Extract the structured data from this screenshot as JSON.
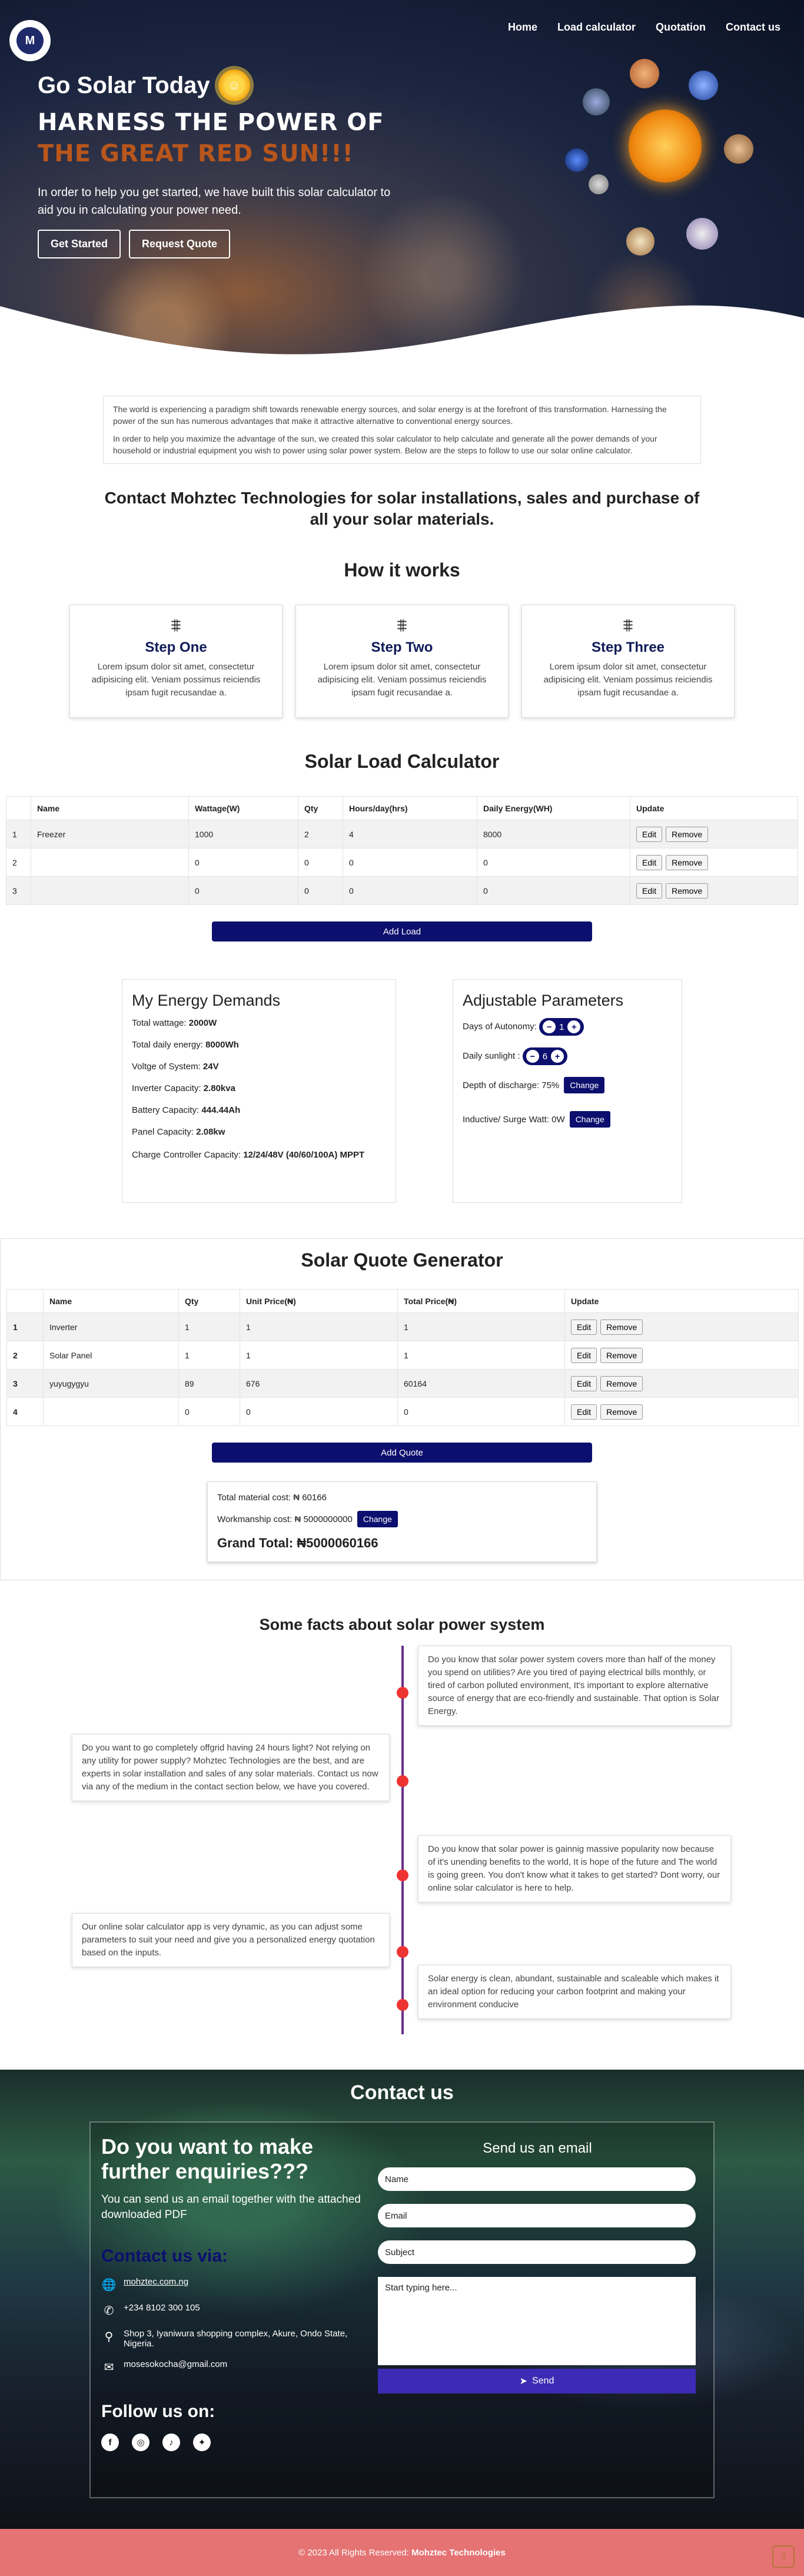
{
  "nav": {
    "logo": "M",
    "items": [
      "Home",
      "Load calculator",
      "Quotation",
      "Contact us"
    ]
  },
  "hero": {
    "title": "Go Solar Today",
    "line1": "HARNESS THE POWER OF",
    "line2": "THE GREAT RED SUN!!!",
    "text": "In order to help you get started, we have built this solar calculator to aid you in calculating your power need.",
    "btn_start": "Get Started",
    "btn_quote": "Request Quote",
    "accent": "#b8561c"
  },
  "intro": {
    "p1": "The world is experiencing a paradigm shift towards renewable energy sources, and solar energy is at the forefront of this transformation. Harnessing the power of the sun has numerous advantages that make it attractive alternative to conventional energy sources.",
    "p2": "In order to help you maximize the advantage of the sun, we created this solar calculator to help calculate and generate all the power demands of your household or industrial equipment you wish to power using solar power system. Below are the steps to follow to use our solar online calculator."
  },
  "contact_heading": "Contact Mohztec Technologies for solar installations, sales and purchase of all your solar materials.",
  "how": {
    "title": "How it works",
    "steps": [
      {
        "title": "Step One",
        "text": "Lorem ipsum dolor sit amet, consectetur adipisicing elit. Veniam possimus reiciendis ipsam fugit recusandae a."
      },
      {
        "title": "Step Two",
        "text": "Lorem ipsum dolor sit amet, consectetur adipisicing elit. Veniam possimus reiciendis ipsam fugit recusandae a."
      },
      {
        "title": "Step Three",
        "text": "Lorem ipsum dolor sit amet, consectetur adipisicing elit. Veniam possimus reiciendis ipsam fugit recusandae a."
      }
    ]
  },
  "calc": {
    "title": "Solar Load Calculator",
    "headers": [
      "",
      "Name",
      "Wattage(W)",
      "Qty",
      "Hours/day(hrs)",
      "Daily Energy(WH)",
      "Update"
    ],
    "rows": [
      [
        "1",
        "Freezer",
        "1000",
        "2",
        "4",
        "8000"
      ],
      [
        "2",
        "",
        "0",
        "0",
        "0",
        "0"
      ],
      [
        "3",
        "",
        "0",
        "0",
        "0",
        "0"
      ]
    ],
    "edit": "Edit",
    "remove": "Remove",
    "add": "Add Load"
  },
  "energy": {
    "title": "My Energy Demands",
    "rows": [
      {
        "label": "Total wattage:",
        "value": "2000W"
      },
      {
        "label": "Total daily energy:",
        "value": "8000Wh"
      },
      {
        "label": "Voltge of System:",
        "value": "24V"
      },
      {
        "label": "Inverter Capacity:",
        "value": "2.80kva"
      },
      {
        "label": "Battery Capacity:",
        "value": "444.44Ah"
      },
      {
        "label": "Panel Capacity:",
        "value": "2.08kw"
      },
      {
        "label": "Charge Controller Capacity:",
        "value": "12/24/48V (40/60/100A) MPPT"
      }
    ]
  },
  "params": {
    "title": "Adjustable Parameters",
    "autonomy_label": "Days of Autonomy:",
    "autonomy": "1",
    "sunlight_label": "Daily sunlight :",
    "sunlight": "6",
    "dod_label": "Depth of discharge: 75%",
    "surge_label": "Inductive/ Surge Watt: 0W",
    "change": "Change"
  },
  "quote": {
    "title": "Solar Quote Generator",
    "headers": [
      "",
      "Name",
      "Qty",
      "Unit Price(₦)",
      "Total Price(₦)",
      "Update"
    ],
    "rows": [
      [
        "1",
        "Inverter",
        "1",
        "1",
        "1"
      ],
      [
        "2",
        "Solar Panel",
        "1",
        "1",
        "1"
      ],
      [
        "3",
        "yuyugygyu",
        "89",
        "676",
        "60164"
      ],
      [
        "4",
        "",
        "0",
        "0",
        "0"
      ]
    ],
    "add": "Add Quote",
    "material_label": "Total material cost:",
    "material": "₦ 60166",
    "workmanship_label": "Workmanship cost:",
    "workmanship": "₦ 5000000000",
    "grand_label": "Grand Total:",
    "grand": "₦5000060166"
  },
  "facts": {
    "title": "Some facts about solar power system",
    "items": [
      "Do you know that solar power system covers more than half of the money you spend on utilities? Are you tired of paying electrical bills monthly, or tired of carbon polluted environment, It's important to explore alternative source of energy that are eco-friendly and sustainable. That option is Solar Energy.",
      "Do you want to go completely offgrid having 24 hours light? Not relying on any utility for power supply? Mohztec Technologies are the best, and are experts in solar installation and sales of any solar materials. Contact us now via any of the medium in the contact section below, we have you covered.",
      "Do you know that solar power is gainnig massive popularity now because of it's unending benefits to the world, It is hope of the future and The world is going green. You don't know what it takes to get started? Dont worry, our online solar calculator is here to help.",
      "Our online solar calculator app is very dynamic, as you can adjust some parameters to suit your need and give you a personalized energy quotation based on the inputs.",
      "Solar energy is clean, abundant, sustainable and scaleable which makes it an ideal option for reducing your carbon footprint and making your environment conducive"
    ]
  },
  "contact": {
    "title": "Contact us",
    "heading": "Do you want to make further enquiries???",
    "sub": "You can send us an email together with the attached downloaded PDF",
    "via": "Contact us via:",
    "website": "mohztec.com.ng",
    "phone": "+234 8102 300 105",
    "address": "Shop 3, Iyaniwura shopping complex, Akure, Ondo State, Nigeria.",
    "email": "mosesokocha@gmail.com",
    "follow": "Follow us on:",
    "form_title": "Send us an email",
    "name_ph": "Name",
    "email_ph": "Email",
    "subject_ph": "Subject",
    "msg_ph": "Start typing here...",
    "send": "Send"
  },
  "footer": {
    "copy": "© 2023 All Rights Reserved:",
    "brand": "Mohztec Technologies"
  }
}
